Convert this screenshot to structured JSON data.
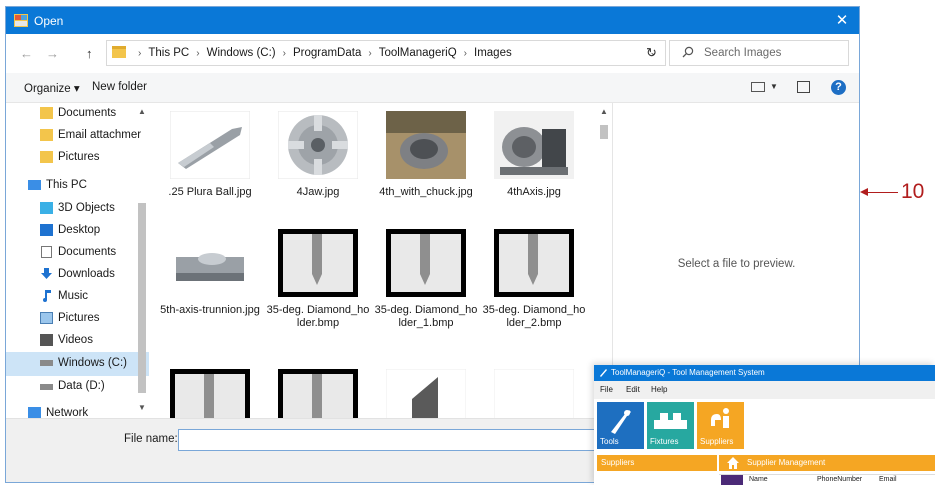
{
  "dialog": {
    "title": "Open",
    "close_glyph": "✕"
  },
  "nav_buttons": {
    "back": "←",
    "forward": "→",
    "up": "↑"
  },
  "address": {
    "crumbs": [
      "This PC",
      "Windows (C:)",
      "ProgramData",
      "ToolManageriQ",
      "Images"
    ],
    "separator": "›",
    "dropdown_glyph": "⌄",
    "refresh_glyph": "↻"
  },
  "search": {
    "placeholder": "Search Images",
    "icon": "search-icon"
  },
  "toolbar": {
    "organize_label": "Organize ▾",
    "new_folder_label": "New folder",
    "help_label": "?"
  },
  "nav_pane": {
    "items": [
      {
        "label": "Documents",
        "icon": "folder-icon"
      },
      {
        "label": "Email attachmer",
        "icon": "folder-icon"
      },
      {
        "label": "Pictures",
        "icon": "folder-icon"
      },
      {
        "label": "This PC",
        "icon": "computer-icon"
      },
      {
        "label": "3D Objects",
        "icon": "cube-icon"
      },
      {
        "label": "Desktop",
        "icon": "desktop-icon"
      },
      {
        "label": "Documents",
        "icon": "document-icon"
      },
      {
        "label": "Downloads",
        "icon": "download-icon"
      },
      {
        "label": "Music",
        "icon": "music-icon"
      },
      {
        "label": "Pictures",
        "icon": "pictures-icon"
      },
      {
        "label": "Videos",
        "icon": "video-icon"
      },
      {
        "label": "Windows (C:)",
        "icon": "drive-icon",
        "selected": true
      },
      {
        "label": "Data (D:)",
        "icon": "drive-icon"
      },
      {
        "label": "Network",
        "icon": "network-icon"
      }
    ]
  },
  "files": [
    {
      "name": ".25 Plura Ball.jpg",
      "kind": "drill-bit"
    },
    {
      "name": "4Jaw.jpg",
      "kind": "chuck"
    },
    {
      "name": "4th_with_chuck.jpg",
      "kind": "photo-chuck"
    },
    {
      "name": "4thAxis.jpg",
      "kind": "photo-axis"
    },
    {
      "name": "5th-axis-trunnion.jpg",
      "kind": "trunnion"
    },
    {
      "name": "35-deg. Diamond_holder.bmp",
      "kind": "holder"
    },
    {
      "name": "35-deg. Diamond_holder_1.bmp",
      "kind": "holder"
    },
    {
      "name": "35-deg. Diamond_holder_2.bmp",
      "kind": "holder"
    },
    {
      "name": "",
      "kind": "holder"
    },
    {
      "name": "",
      "kind": "holder"
    },
    {
      "name": "",
      "kind": "insert"
    },
    {
      "name": "",
      "kind": "blank"
    }
  ],
  "preview": {
    "message": "Select a file to preview."
  },
  "bottom": {
    "file_name_label": "File name:",
    "file_name_value": ""
  },
  "callout": {
    "number": "10"
  },
  "overlay_app": {
    "title": "ToolManageriQ - Tool Management System",
    "menu": [
      "File",
      "Edit",
      "Help"
    ],
    "ribbon": [
      {
        "label": "Tools",
        "color": "#1e6fc0"
      },
      {
        "label": "Fixtures",
        "color": "#27a8a0"
      },
      {
        "label": "Suppliers",
        "color": "#f5a623"
      }
    ],
    "left_panel_title": "Suppliers",
    "right_panel_title": "Supplier Management",
    "columns": [
      "Name",
      "PhoneNumber",
      "Email"
    ]
  },
  "colors": {
    "titlebar": "#0a78d7",
    "accent_orange": "#f5a623",
    "callout_red": "#b11d1d"
  }
}
